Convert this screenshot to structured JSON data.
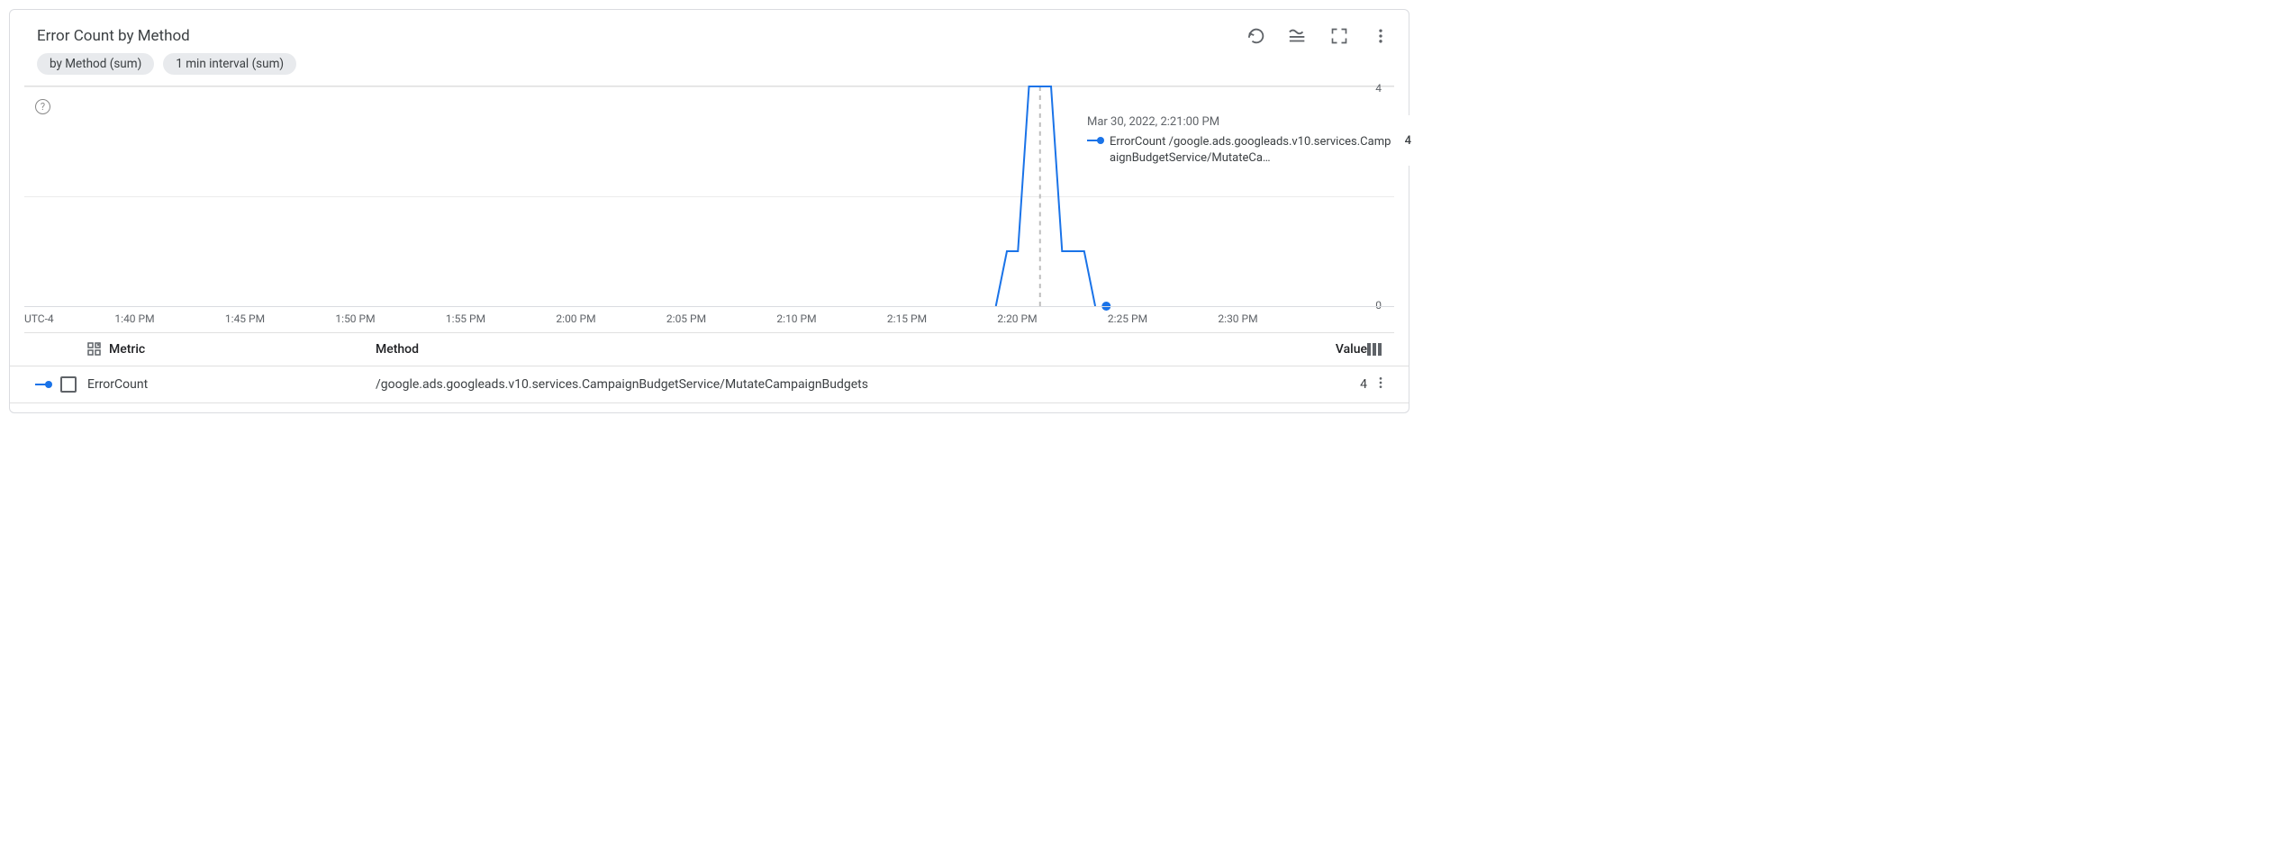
{
  "title": "Error Count by Method",
  "chips": [
    "by Method (sum)",
    "1 min interval (sum)"
  ],
  "y_ticks": [
    "4",
    "0"
  ],
  "x_tz": "UTC-4",
  "x_ticks": [
    "1:40 PM",
    "1:45 PM",
    "1:50 PM",
    "1:55 PM",
    "2:00 PM",
    "2:05 PM",
    "2:10 PM",
    "2:15 PM",
    "2:20 PM",
    "2:25 PM",
    "2:30 PM"
  ],
  "tooltip": {
    "time": "Mar 30, 2022, 2:21:00 PM",
    "label": "ErrorCount /google.ads.googleads.v10.services.CampaignBudgetService/MutateCa…",
    "value": "4"
  },
  "columns": {
    "metric": "Metric",
    "method": "Method",
    "value": "Value"
  },
  "rows": [
    {
      "metric": "ErrorCount",
      "method": "/google.ads.googleads.v10.services.CampaignBudgetService/MutateCampaignBudgets",
      "value": "4"
    }
  ],
  "chart_data": {
    "type": "line",
    "title": "Error Count by Method",
    "xlabel": "",
    "ylabel": "",
    "ylim": [
      0,
      4
    ],
    "x_range_minutes": [
      95,
      155
    ],
    "x_tick_labels": [
      "1:40 PM",
      "1:45 PM",
      "1:50 PM",
      "1:55 PM",
      "2:00 PM",
      "2:05 PM",
      "2:10 PM",
      "2:15 PM",
      "2:20 PM",
      "2:25 PM",
      "2:30 PM"
    ],
    "series": [
      {
        "name": "ErrorCount /google.ads.googleads.v10.services.CampaignBudgetService/MutateCampaignBudgets",
        "color": "#1a73e8",
        "points": [
          {
            "t_min": 139,
            "v": 0
          },
          {
            "t_min": 139.5,
            "v": 1
          },
          {
            "t_min": 140,
            "v": 1
          },
          {
            "t_min": 140.5,
            "v": 4
          },
          {
            "t_min": 141.5,
            "v": 4
          },
          {
            "t_min": 142,
            "v": 1
          },
          {
            "t_min": 143,
            "v": 1
          },
          {
            "t_min": 143.5,
            "v": 0
          }
        ]
      }
    ],
    "cursor": {
      "t_min": 141,
      "v": 4
    },
    "marker_end": {
      "t_min": 144,
      "v": 0
    }
  }
}
